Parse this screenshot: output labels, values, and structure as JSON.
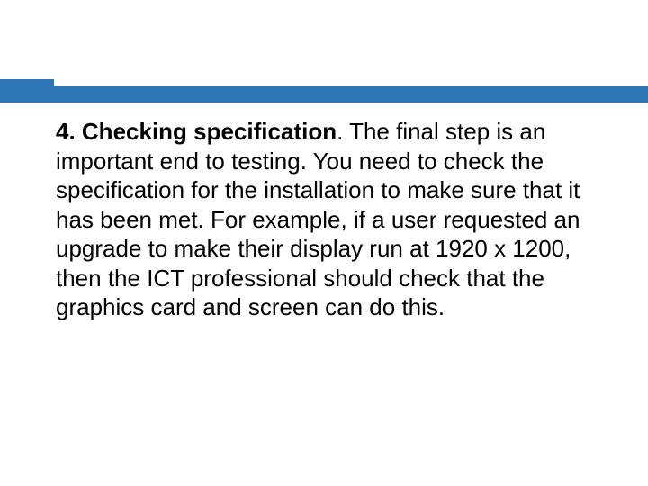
{
  "colors": {
    "accent": "#2e75b6"
  },
  "slide": {
    "bold_lead": "4. Checking specification",
    "body_text": ". The final step is an important end to testing. You need  to check the specification for the installation to make sure that it has been met. For example, if a user requested an upgrade to make their display run at 1920 x 1200, then the ICT professional should check that the graphics card and screen can do this."
  }
}
